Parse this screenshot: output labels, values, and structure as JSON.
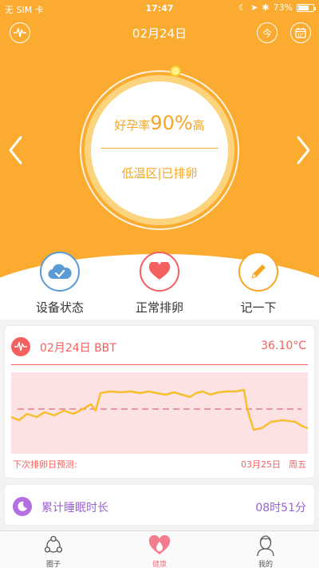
{
  "status_bar": {
    "carrier": "无 SIM 卡",
    "time": "17:47",
    "battery": "73%",
    "battery_level": 0.73
  },
  "header": {
    "title": "02月24日",
    "today_label": "今",
    "left_icon": "waveform-icon",
    "right_icon": "calendar-icon"
  },
  "cycle_ring": {
    "rate_prefix": "好孕率",
    "rate_value": "90%",
    "rate_suffix": "高",
    "phase": "低温区|已排卵"
  },
  "actions": [
    {
      "label": "设备状态",
      "icon": "cloud-check-icon",
      "color": "#5b9bd5"
    },
    {
      "label": "正常排卵",
      "icon": "heart-icon",
      "color": "#f4605e"
    },
    {
      "label": "记一下",
      "icon": "pencil-icon",
      "color": "#f5a623"
    }
  ],
  "bbt_card": {
    "title": "02月24日 BBT",
    "temperature": "36.10°C",
    "predict_label": "下次排卵日预测:",
    "predict_date": "03月25日",
    "predict_weekday": "周五"
  },
  "sleep_card": {
    "title": "累计睡眠时长",
    "value": "08时51分"
  },
  "tabbar": {
    "items": [
      {
        "label": "圈子",
        "icon": "community-icon",
        "active": false
      },
      {
        "label": "健康",
        "icon": "health-heart-icon",
        "active": true
      },
      {
        "label": "我的",
        "icon": "profile-icon",
        "active": false
      }
    ]
  },
  "colors": {
    "primary": "#fbab2f",
    "bbt": "#f4605e",
    "sleep": "#9b5fd6",
    "chart_line": "#f7bf2e",
    "chart_bg": "#fde2e4"
  }
}
